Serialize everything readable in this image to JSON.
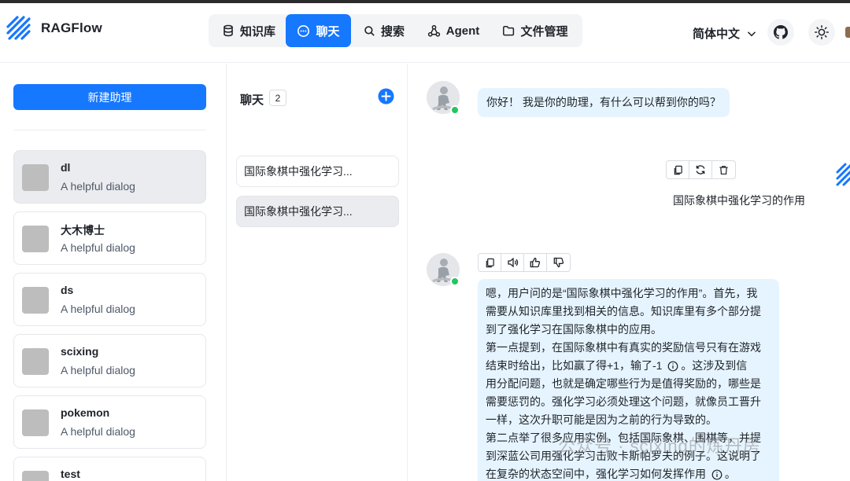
{
  "app": {
    "brand": "RAGFlow"
  },
  "nav": {
    "items": [
      {
        "label": "知识库",
        "icon": "database-icon"
      },
      {
        "label": "聊天",
        "icon": "chat-icon",
        "active": true
      },
      {
        "label": "搜索",
        "icon": "search-icon"
      },
      {
        "label": "Agent",
        "icon": "agent-graph-icon"
      },
      {
        "label": "文件管理",
        "icon": "folder-icon"
      }
    ],
    "language": "简体中文",
    "accent": "#1677ff"
  },
  "assistants": {
    "new_button": "新建助理",
    "items": [
      {
        "name": "dl",
        "desc": "A helpful dialog",
        "selected": true
      },
      {
        "name": "大木博士",
        "desc": "A helpful dialog"
      },
      {
        "name": "ds",
        "desc": "A helpful dialog"
      },
      {
        "name": "scixing",
        "desc": "A helpful dialog"
      },
      {
        "name": "pokemon",
        "desc": "A helpful dialog"
      },
      {
        "name": "test",
        "desc": ""
      }
    ]
  },
  "conversations": {
    "title": "聊天",
    "count": "2",
    "items": [
      {
        "label": "国际象棋中强化学习..."
      },
      {
        "label": "国际象棋中强化学习...",
        "selected": true
      }
    ]
  },
  "chat": {
    "greeting": "你好！ 我是你的助理，有什么可以帮到你的吗？",
    "user_message": "国际象棋中强化学习的作用",
    "answer_lines": [
      "嗯，用户问的是“国际象棋中强化学习的作用”。首先，我",
      "需要从知识库里找到相关的信息。知识库里有多个部分提",
      "到了强化学习在国际象棋中的应用。",
      "第一点提到，在国际象棋中有真实的奖励信号只有在游戏",
      "结束时给出，比如赢了得+1，输了-1 ",
      "。这涉及到信",
      "用分配问题，也就是确定哪些行为是值得奖励的，哪些是",
      "需要惩罚的。强化学习必须处理这个问题，就像员工晋升",
      "一样，这次升职可能是因为之前的行为导致的。",
      "第二点举了很多应用实例，包括国际象棋、围棋等，并提",
      "到深蓝公司用强化学习击败卡斯帕罗夫的例子。这说明了",
      "在复杂的状态空间中，强化学习如何发挥作用 ",
      "。"
    ],
    "watermark": "公众号 · scixing的炼丹房"
  }
}
